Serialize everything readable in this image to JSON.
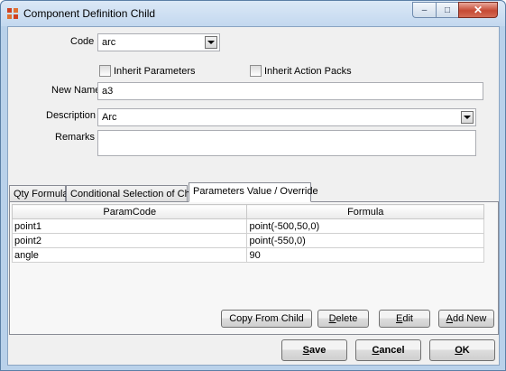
{
  "window": {
    "title": "Component Definition Child",
    "minimize_glyph": "–",
    "maximize_glyph": "□",
    "close_glyph": "✕"
  },
  "form": {
    "code_label": "Code",
    "code_value": "arc",
    "inherit_params_label": "Inherit Parameters",
    "inherit_params_checked": false,
    "inherit_action_label": "Inherit Action Packs",
    "inherit_action_checked": false,
    "new_name_label": "New Name",
    "new_name_value": "a3",
    "description_label": "Description",
    "description_value": "Arc",
    "remarks_label": "Remarks",
    "remarks_value": ""
  },
  "tabs": [
    {
      "label": "Qty Formula",
      "active": false
    },
    {
      "label": "Conditional Selection of Child",
      "active": false
    },
    {
      "label": "Parameters Value / Override",
      "active": true
    }
  ],
  "grid": {
    "columns": [
      "ParamCode",
      "Formula"
    ],
    "rows": [
      [
        "point1",
        "point(-500,50,0)"
      ],
      [
        "point2",
        "point(-550,0)"
      ],
      [
        "angle",
        "90"
      ]
    ]
  },
  "panel_buttons": {
    "copy_from_child": "Copy From Child",
    "delete_pre": "",
    "delete_ul": "D",
    "delete_post": "elete",
    "edit_pre": "",
    "edit_ul": "E",
    "edit_post": "dit",
    "add_new_pre": "",
    "add_new_ul": "A",
    "add_new_post": "dd New"
  },
  "dialog_buttons": {
    "save_ul": "S",
    "save_post": "ave",
    "cancel_ul": "C",
    "cancel_post": "ancel",
    "ok_ul": "O",
    "ok_post": "K"
  }
}
